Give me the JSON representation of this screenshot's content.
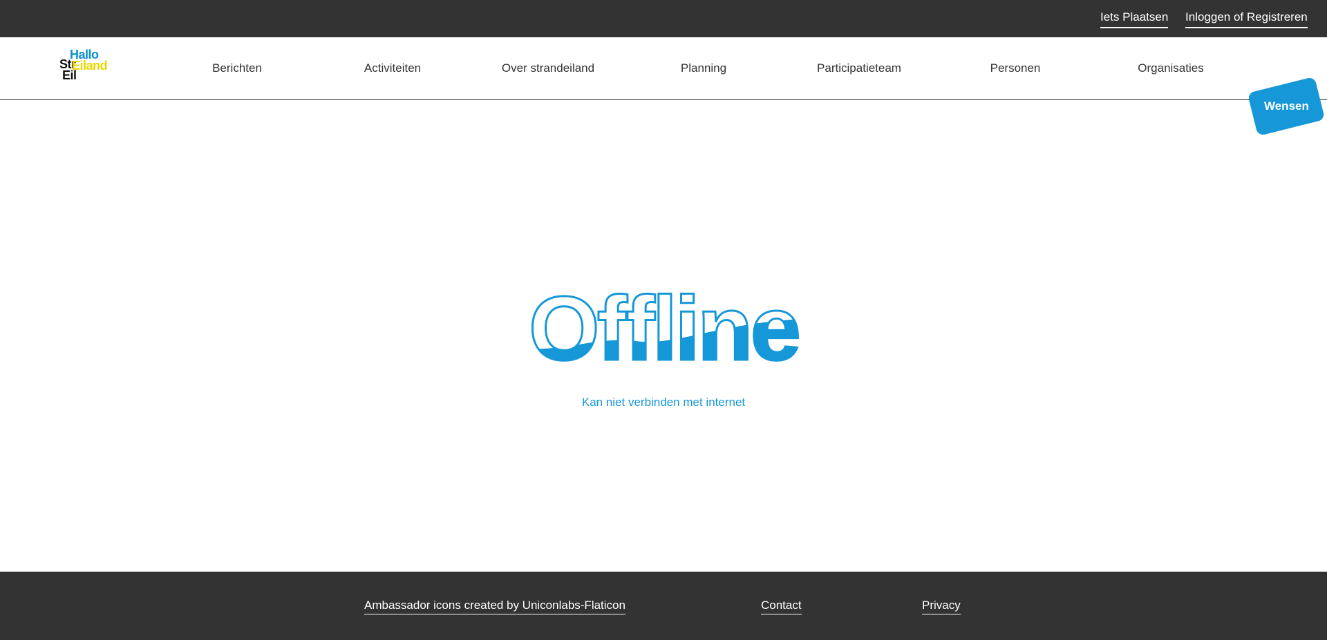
{
  "topbar": {
    "post_label": "Iets Plaatsen",
    "login_label": "Inloggen of Registreren"
  },
  "logo": {
    "line1": "Hallo",
    "line2": "Str",
    "line2b": "Eiland",
    "line3": "Eil"
  },
  "nav": {
    "items": [
      {
        "label": "Berichten"
      },
      {
        "label": "Activiteiten"
      },
      {
        "label": "Over strandeiland"
      },
      {
        "label": "Planning"
      },
      {
        "label": "Participatieteam"
      },
      {
        "label": "Personen"
      },
      {
        "label": "Organisaties"
      }
    ],
    "wishes_label": "Wensen"
  },
  "main": {
    "heading": "Offline",
    "subtitle": "Kan niet verbinden met internet"
  },
  "footer": {
    "credits_label": "Ambassador icons created by Uniconlabs-Flaticon",
    "contact_label": "Contact",
    "privacy_label": "Privacy"
  },
  "colors": {
    "accent": "#1597d8",
    "dark": "#333333",
    "logo_yellow": "#e8d600",
    "background": "#ffffff"
  }
}
